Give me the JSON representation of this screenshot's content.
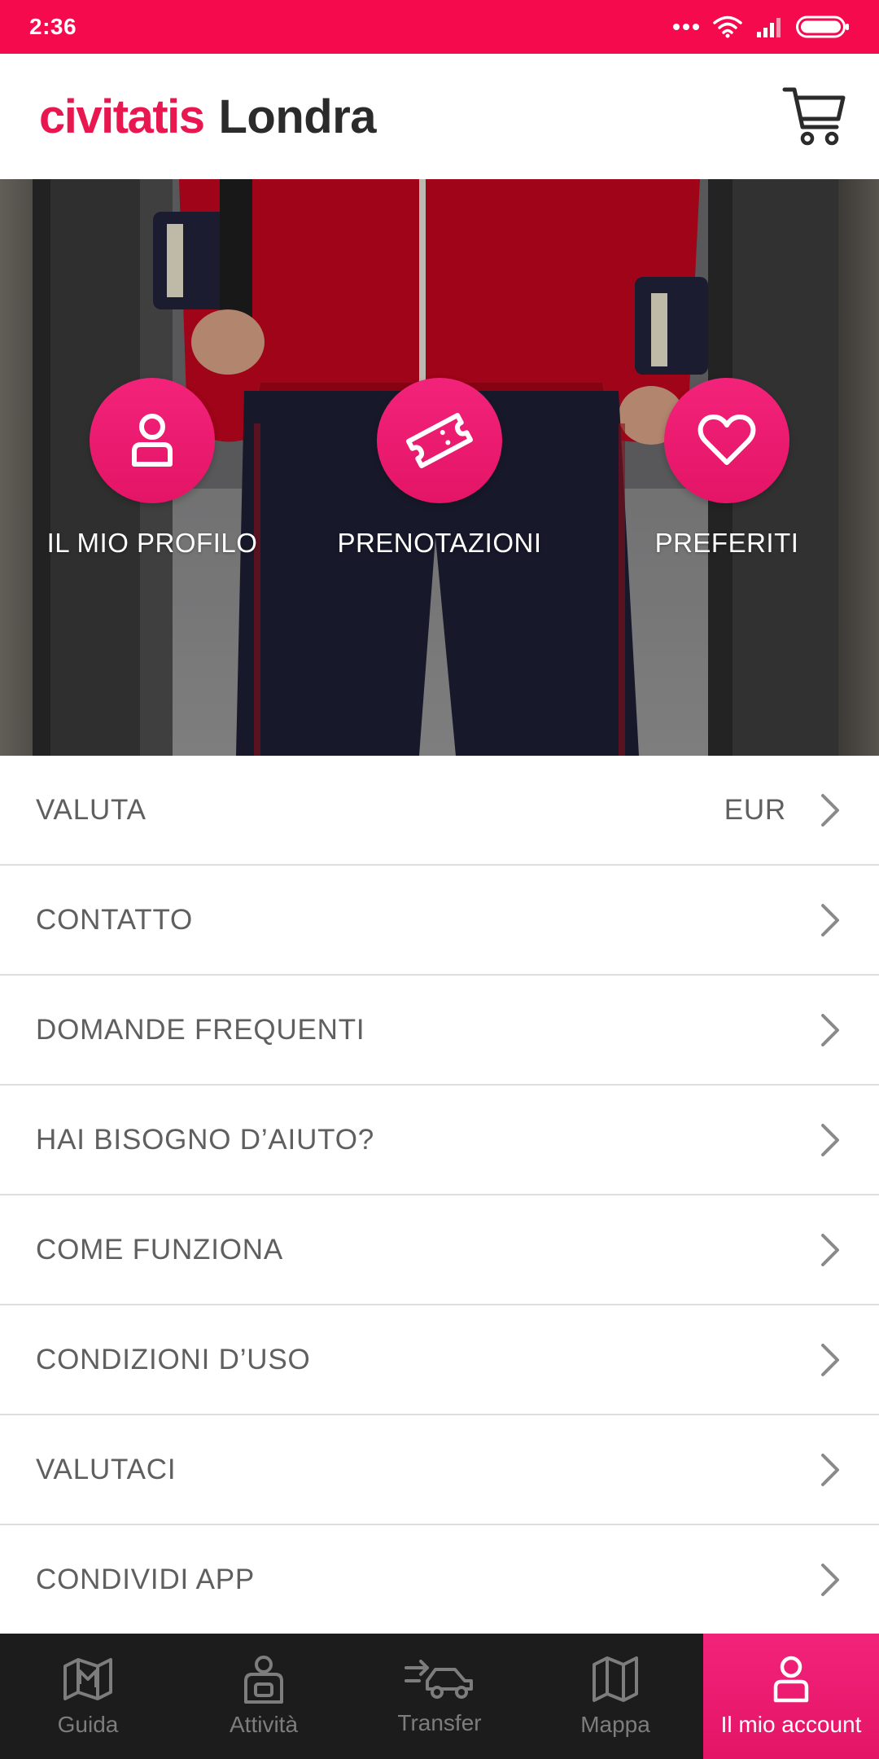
{
  "status_bar": {
    "time": "2:36"
  },
  "header": {
    "brand": "civitatis",
    "city": "Londra"
  },
  "hero": {
    "actions": [
      {
        "label": "IL MIO PROFILO",
        "icon": "user-icon"
      },
      {
        "label": "PRENOTAZIONI",
        "icon": "ticket-icon"
      },
      {
        "label": "PREFERITI",
        "icon": "heart-icon"
      }
    ]
  },
  "menu": {
    "items": [
      {
        "label": "VALUTA",
        "value": "EUR"
      },
      {
        "label": "CONTATTO"
      },
      {
        "label": "DOMANDE FREQUENTI"
      },
      {
        "label": "HAI BISOGNO D’AIUTO?"
      },
      {
        "label": "COME FUNZIONA"
      },
      {
        "label": "CONDIZIONI D’USO"
      },
      {
        "label": "VALUTACI"
      },
      {
        "label": "CONDIVIDI APP"
      }
    ]
  },
  "bottom_nav": {
    "active": "Il mio account",
    "tabs": [
      {
        "label": "Guida",
        "icon": "map-pin-icon"
      },
      {
        "label": "Attività",
        "icon": "activities-icon"
      },
      {
        "label": "Transfer",
        "icon": "transfer-car-icon"
      },
      {
        "label": "Mappa",
        "icon": "map-icon"
      },
      {
        "label": "Il mio account",
        "icon": "user-icon"
      }
    ]
  },
  "colors": {
    "accent": "#f50a4d",
    "brand": "#e8174f",
    "nav_background": "#1c1c1d",
    "menu_text": "#5f5f5f"
  }
}
